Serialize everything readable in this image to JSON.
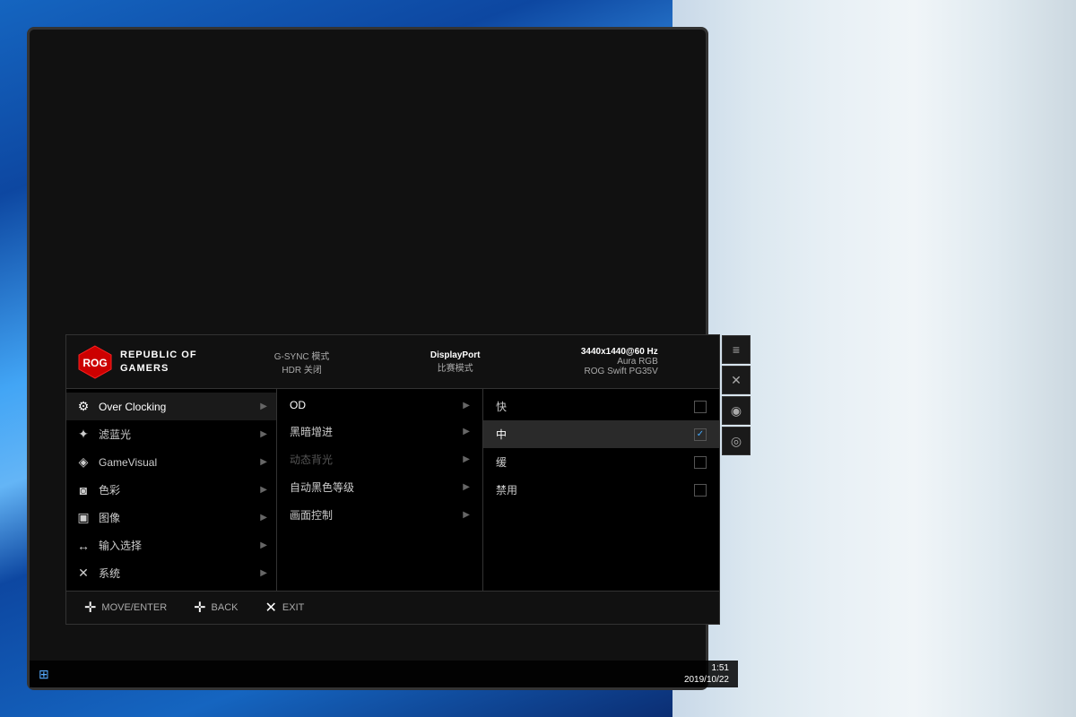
{
  "desktop": {
    "taskbar": {
      "time": "1:51",
      "date": "2019/10/22"
    }
  },
  "osd": {
    "header": {
      "brand": "REPUBLIC OF\nGAMERS",
      "gsync_label": "G-SYNC 模式",
      "hdr_label": "HDR 关闭",
      "port_label": "DisplayPort",
      "mode_label": "比赛模式",
      "resolution": "3440x1440@60 Hz",
      "rgb_label": "Aura RGB",
      "model": "ROG Swift PG35V"
    },
    "menu_left": {
      "items": [
        {
          "icon": "⚙",
          "label": "Over Clocking",
          "active": true
        },
        {
          "icon": "✦",
          "label": "滤蓝光",
          "active": false
        },
        {
          "icon": "◈",
          "label": "GameVisual",
          "active": false
        },
        {
          "icon": "◙",
          "label": "色彩",
          "active": false
        },
        {
          "icon": "▣",
          "label": "图像",
          "active": false
        },
        {
          "icon": "↔",
          "label": "输入选择",
          "active": false
        },
        {
          "icon": "✕",
          "label": "系统",
          "active": false
        }
      ]
    },
    "menu_middle": {
      "items": [
        {
          "label": "OD",
          "active": true,
          "disabled": false
        },
        {
          "label": "黑暗增进",
          "active": false,
          "disabled": false
        },
        {
          "label": "动态背光",
          "active": false,
          "disabled": true
        },
        {
          "label": "自动黑色等级",
          "active": false,
          "disabled": false
        },
        {
          "label": "画面控制",
          "active": false,
          "disabled": false
        }
      ]
    },
    "menu_right": {
      "items": [
        {
          "label": "快",
          "selected": false,
          "checked": false
        },
        {
          "label": "中",
          "selected": true,
          "checked": true
        },
        {
          "label": "缓",
          "selected": false,
          "checked": false
        },
        {
          "label": "禁用",
          "selected": false,
          "checked": false
        }
      ]
    },
    "footer": {
      "move_label": "MOVE/ENTER",
      "back_label": "BACK",
      "exit_label": "EXIT"
    },
    "side_buttons": [
      "≡",
      "✕",
      "🎮",
      "🎧"
    ]
  }
}
